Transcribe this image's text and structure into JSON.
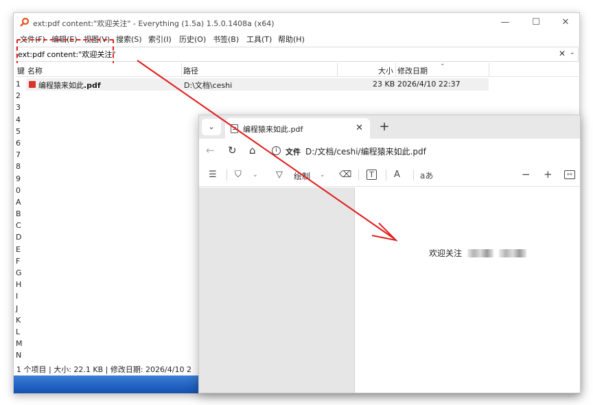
{
  "everything": {
    "title": "ext:pdf content:\"欢迎关注\" - Everything (1.5a) 1.5.0.1408a (x64)",
    "window_controls": {
      "minimize": "—",
      "maximize": "☐",
      "close": "✕"
    },
    "menu": [
      "文件(F)",
      "编辑(E)",
      "视图(V)",
      "搜索(S)",
      "索引(I)",
      "历史(O)",
      "书签(B)",
      "工具(T)",
      "帮助(H)"
    ],
    "search_value": "ext:pdf content:\"欢迎关注\"",
    "search_clear": "✕",
    "search_dropdown": "⌄",
    "columns": {
      "key": "键",
      "name": "名称",
      "path": "路径",
      "size": "大小",
      "modified": "修改日期"
    },
    "sort_indicator": "⌄",
    "keys": [
      "1",
      "2",
      "3",
      "4",
      "5",
      "6",
      "7",
      "8",
      "9",
      "0",
      "A",
      "B",
      "C",
      "D",
      "E",
      "F",
      "G",
      "H",
      "I",
      "J",
      "K",
      "L",
      "M",
      "N"
    ],
    "results": [
      {
        "name_prefix": "编程猿来如此",
        "name_ext": ".pdf",
        "path": "D:\\文档\\ceshi",
        "size": "23 KB",
        "modified": "2026/4/10 22:37"
      }
    ],
    "status": "1 个项目  |  大小: 22.1 KB  |  修改日期: 2026/4/10 2"
  },
  "edge": {
    "tab_list": "⌄",
    "tab_title": "编程猿来如此.pdf",
    "tab_close": "✕",
    "new_tab": "+",
    "back": "←",
    "refresh": "↻",
    "home": "⌂",
    "info": "i",
    "scheme": "文件",
    "url": "D:/文档/ceshi/编程猿来如此.pdf",
    "toolbar": {
      "contents": "☰",
      "highlight": "⛉",
      "draw_label": "绘制",
      "eraser": "⌫",
      "text_box": "T",
      "read_aloud": "A",
      "translate": "aあ",
      "zoom_out": "−",
      "zoom_in": "+",
      "fit": "⇿",
      "dropdown": "⌄"
    },
    "page_text": "欢迎关注"
  },
  "colors": {
    "highlight": "#e02020",
    "arrow": "#e02020"
  }
}
